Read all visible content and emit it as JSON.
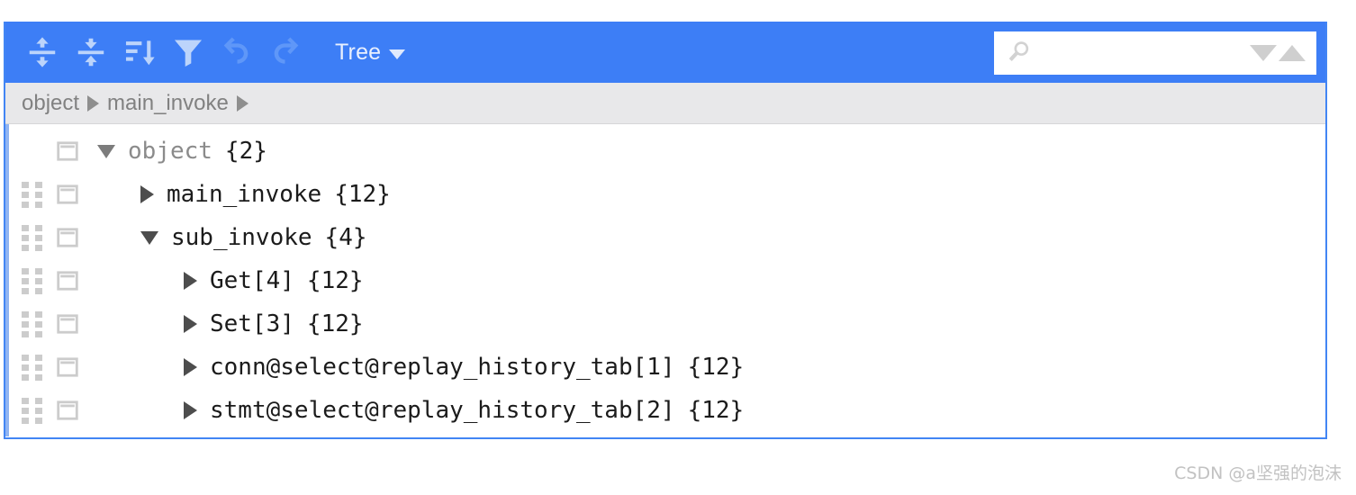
{
  "colors": {
    "toolbar_blue": "#3d7ef6",
    "panel_border": "#4285f4",
    "breadcrumb_bg": "#e8e8ea",
    "left_rail": "#8fb4f2",
    "icon_light": "#bcd4fb",
    "icon_disabled": "#5f97f8",
    "label_dark": "#1b1b1b",
    "label_muted": "#8b8b8b"
  },
  "toolbar": {
    "buttons": [
      {
        "name": "expand-all-icon",
        "title": "Expand all",
        "enabled": true
      },
      {
        "name": "collapse-all-icon",
        "title": "Collapse all",
        "enabled": true
      },
      {
        "name": "sort-icon",
        "title": "Sort",
        "enabled": true
      },
      {
        "name": "filter-icon",
        "title": "Filter",
        "enabled": true
      },
      {
        "name": "undo-icon",
        "title": "Undo",
        "enabled": false
      },
      {
        "name": "redo-icon",
        "title": "Redo",
        "enabled": false
      }
    ],
    "mode_menu": {
      "label": "Tree",
      "caret": "chevron-down-icon"
    },
    "search": {
      "value": "",
      "placeholder": "",
      "icon": "search-icon",
      "next_icon": "triangle-down-icon",
      "prev_icon": "triangle-up-icon"
    }
  },
  "breadcrumb": {
    "items": [
      "object",
      "main_invoke"
    ],
    "separator": "▶",
    "trailing_separator": true
  },
  "tree": {
    "rows": [
      {
        "level": 0,
        "drag_handle": false,
        "card_icon": "card-icon",
        "expanded": true,
        "toggle": "▼",
        "label": "object",
        "label_style": "muted",
        "count": "{2}"
      },
      {
        "level": 1,
        "drag_handle": true,
        "card_icon": "card-icon",
        "expanded": false,
        "toggle": "▶",
        "label": "main_invoke",
        "label_style": "dark",
        "count": "{12}"
      },
      {
        "level": 1,
        "drag_handle": true,
        "card_icon": "card-icon",
        "expanded": true,
        "toggle": "▼",
        "label": "sub_invoke",
        "label_style": "dark",
        "count": "{4}"
      },
      {
        "level": 2,
        "drag_handle": true,
        "card_icon": "card-icon",
        "expanded": false,
        "toggle": "▶",
        "label": "Get[4]",
        "label_style": "dark",
        "count": "{12}"
      },
      {
        "level": 2,
        "drag_handle": true,
        "card_icon": "card-icon",
        "expanded": false,
        "toggle": "▶",
        "label": "Set[3]",
        "label_style": "dark",
        "count": "{12}"
      },
      {
        "level": 2,
        "drag_handle": true,
        "card_icon": "card-icon",
        "expanded": false,
        "toggle": "▶",
        "label": "conn@select@replay_history_tab[1]",
        "label_style": "dark",
        "count": "{12}"
      },
      {
        "level": 2,
        "drag_handle": true,
        "card_icon": "card-icon",
        "expanded": false,
        "toggle": "▶",
        "label": "stmt@select@replay_history_tab[2]",
        "label_style": "dark",
        "count": "{12}"
      }
    ]
  },
  "watermark": {
    "text": "CSDN @a坚强的泡沫"
  }
}
